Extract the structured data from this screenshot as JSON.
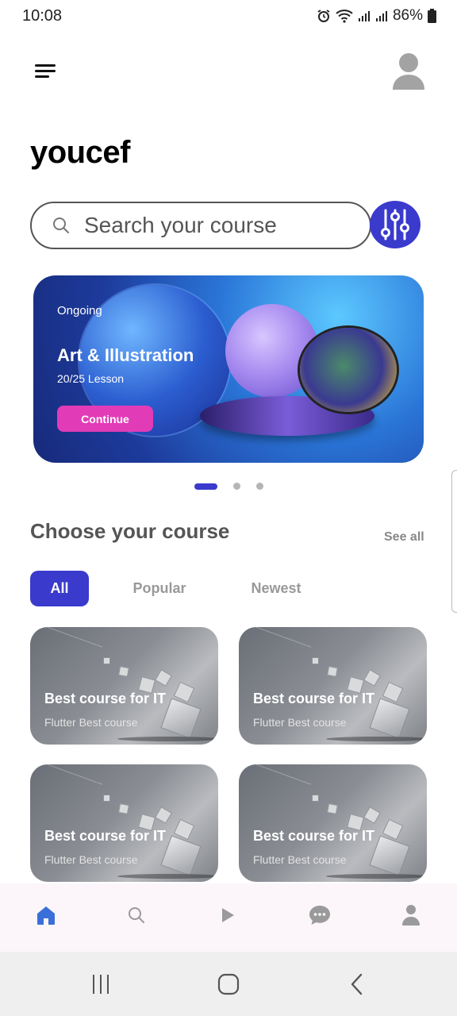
{
  "status": {
    "time": "10:08",
    "battery": "86%"
  },
  "header": {
    "user_name": "youcef"
  },
  "search": {
    "placeholder": "Search your course"
  },
  "banner": {
    "tag": "Ongoing",
    "title": "Art & Illustration",
    "lessons": "20/25 Lesson",
    "button_label": "Continue",
    "page_count": 3,
    "active_page": 1
  },
  "section": {
    "title": "Choose your course",
    "see_all": "See all"
  },
  "tabs": [
    {
      "label": "All",
      "active": true
    },
    {
      "label": "Popular",
      "active": false
    },
    {
      "label": "Newest",
      "active": false
    }
  ],
  "courses": [
    {
      "title": "Best course for IT",
      "subtitle": "Flutter Best course"
    },
    {
      "title": "Best course for IT",
      "subtitle": "Flutter Best course"
    },
    {
      "title": "Best course for IT",
      "subtitle": "Flutter Best course"
    },
    {
      "title": "Best course for IT",
      "subtitle": "Flutter Best course"
    }
  ],
  "bottom_nav": [
    {
      "icon": "home-icon",
      "active": true
    },
    {
      "icon": "search-icon",
      "active": false
    },
    {
      "icon": "play-icon",
      "active": false
    },
    {
      "icon": "chat-icon",
      "active": false
    },
    {
      "icon": "profile-icon",
      "active": false
    }
  ],
  "colors": {
    "accent": "#3a3acd",
    "continue": "#e23bb7",
    "nav_active": "#3b6fd8",
    "nav_inactive": "#9a9a9a"
  }
}
